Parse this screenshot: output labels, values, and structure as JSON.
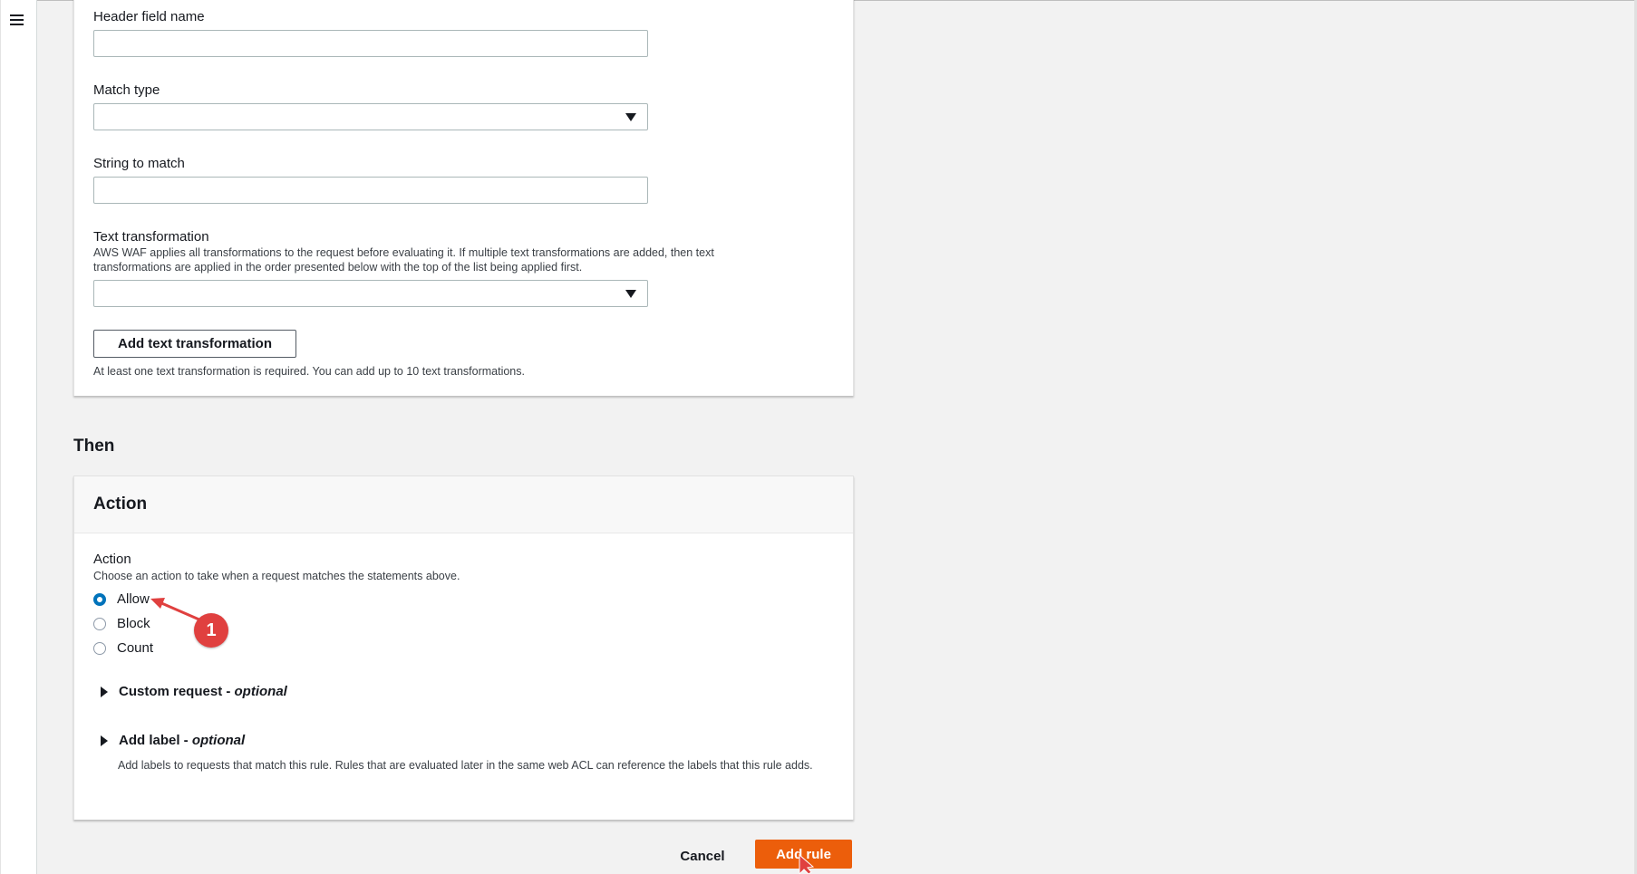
{
  "nav": {
    "menu_icon": "hamburger-icon"
  },
  "statement": {
    "header_field_label": "Header field name",
    "header_field_value": "",
    "match_type_label": "Match type",
    "match_type_value": "",
    "string_to_match_label": "String to match",
    "string_to_match_value": "",
    "text_transformation_label": "Text transformation",
    "text_transformation_description": "AWS WAF applies all transformations to the request before evaluating it. If multiple text transformations are added, then text transformations are applied in the order presented below with the top of the list being applied first.",
    "text_transformation_value": "",
    "add_transformation_button": "Add text transformation",
    "transformation_hint": "At least one text transformation is required. You can add up to 10 text transformations."
  },
  "then": {
    "heading": "Then"
  },
  "action_panel": {
    "title": "Action",
    "field_label": "Action",
    "field_description": "Choose an action to take when a request matches the statements above.",
    "options": [
      {
        "label": "Allow",
        "selected": true
      },
      {
        "label": "Block",
        "selected": false
      },
      {
        "label": "Count",
        "selected": false
      }
    ],
    "custom_request": {
      "label": "Custom request - ",
      "suffix": "optional"
    },
    "add_label": {
      "label": "Add label - ",
      "suffix": "optional",
      "description": "Add labels to requests that match this rule. Rules that are evaluated later in the same web ACL can reference the labels that this rule adds."
    }
  },
  "footer": {
    "cancel_label": "Cancel",
    "add_rule_label": "Add rule"
  },
  "annotation": {
    "step_number": "1",
    "color": "#e0403f"
  },
  "colors": {
    "primary_button": "#ec5e0b",
    "radio_selected": "#0073bb"
  }
}
